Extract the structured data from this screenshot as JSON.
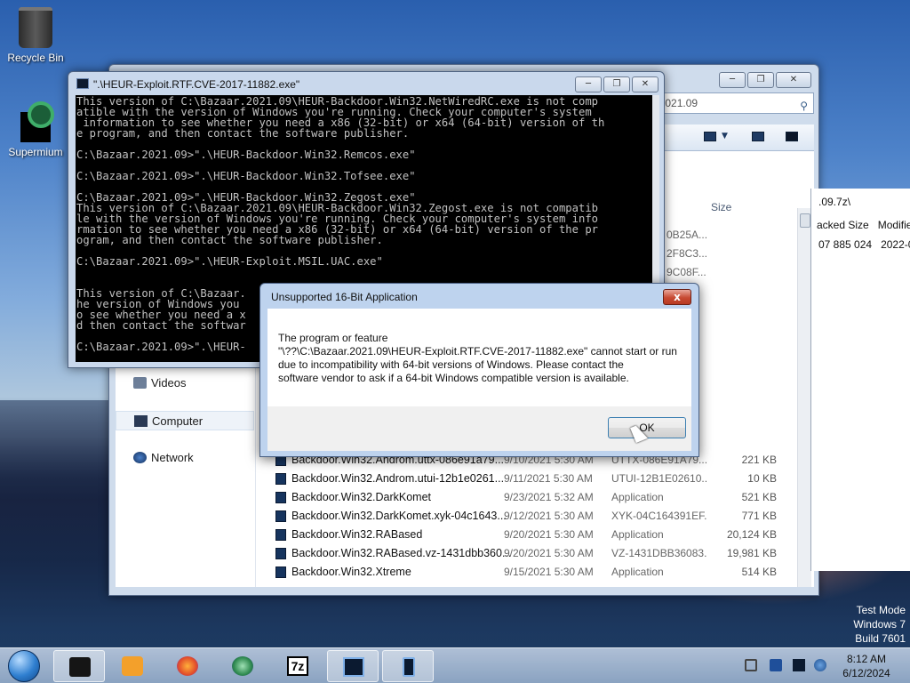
{
  "desktop": {
    "icons": [
      {
        "label": "Recycle Bin",
        "icon": "recycle-bin-icon"
      },
      {
        "label": "Supermium",
        "icon": "supermium-icon"
      }
    ],
    "watermark": [
      "Test Mode",
      "Windows 7",
      "Build 7601"
    ]
  },
  "explorer": {
    "address": "...r.2021.09",
    "column_size": "Size",
    "nav": [
      {
        "label": "Videos",
        "icon": "videos-icon"
      },
      {
        "label": "Computer",
        "icon": "computer-icon"
      },
      {
        "label": "Network",
        "icon": "network-icon"
      }
    ],
    "partial_rows": [
      {
        "type": "0B25A...",
        "size": "942 KB"
      },
      {
        "type": "2F8C3...",
        "size": "3,533 KB"
      },
      {
        "type": "9C08F...",
        "size": "1,217 KB"
      },
      {
        "type": "",
        "size": "820 KB"
      },
      {
        "type": "",
        "size": "599 KB"
      },
      {
        "type": "",
        "size": "550 KB"
      },
      {
        "type": "",
        "size": "5,350 KB"
      },
      {
        "type": "",
        "size": "319 KB"
      },
      {
        "type": "",
        "size": "220 KB"
      },
      {
        "type": "",
        "size": "369 KB"
      },
      {
        "type": "",
        "size": "586 KB"
      },
      {
        "type": "",
        "size": "164 KB"
      }
    ],
    "rows": [
      {
        "name": "Backdoor.Win32.Androm.uttx-086e91a79...",
        "date": "9/10/2021 5:30 AM",
        "type": "UTTX-086E91A79...",
        "size": "221 KB"
      },
      {
        "name": "Backdoor.Win32.Androm.utui-12b1e0261...",
        "date": "9/11/2021 5:30 AM",
        "type": "UTUI-12B1E02610...",
        "size": "10 KB"
      },
      {
        "name": "Backdoor.Win32.DarkKomet",
        "date": "9/23/2021 5:32 AM",
        "type": "Application",
        "size": "521 KB"
      },
      {
        "name": "Backdoor.Win32.DarkKomet.xyk-04c1643...",
        "date": "9/12/2021 5:30 AM",
        "type": "XYK-04C164391EF...",
        "size": "771 KB"
      },
      {
        "name": "Backdoor.Win32.RABased",
        "date": "9/20/2021 5:30 AM",
        "type": "Application",
        "size": "20,124 KB"
      },
      {
        "name": "Backdoor.Win32.RABased.vz-1431dbb360...",
        "date": "9/20/2021 5:30 AM",
        "type": "VZ-1431DBB36083...",
        "size": "19,981 KB"
      },
      {
        "name": "Backdoor.Win32.Xtreme",
        "date": "9/15/2021 5:30 AM",
        "type": "Application",
        "size": "514 KB"
      }
    ]
  },
  "sevenzip": {
    "path": ".09.7z\\",
    "col_packed": "acked Size",
    "col_modified": "Modifie",
    "packed_value": "07 885 024",
    "modified_value": "2022-0"
  },
  "console": {
    "title": "\".\\HEUR-Exploit.RTF.CVE-2017-11882.exe\"",
    "lines": [
      "This version of C:\\Bazaar.2021.09\\HEUR-Backdoor.Win32.NetWiredRC.exe is not comp",
      "atible with the version of Windows you're running. Check your computer's system",
      " information to see whether you need a x86 (32-bit) or x64 (64-bit) version of th",
      "e program, and then contact the software publisher.",
      "",
      "C:\\Bazaar.2021.09>\".\\HEUR-Backdoor.Win32.Remcos.exe\"",
      "",
      "C:\\Bazaar.2021.09>\".\\HEUR-Backdoor.Win32.Tofsee.exe\"",
      "",
      "C:\\Bazaar.2021.09>\".\\HEUR-Backdoor.Win32.Zegost.exe\"",
      "This version of C:\\Bazaar.2021.09\\HEUR-Backdoor.Win32.Zegost.exe is not compatib",
      "le with the version of Windows you're running. Check your computer's system info",
      "rmation to see whether you need a x86 (32-bit) or x64 (64-bit) version of the pr",
      "ogram, and then contact the software publisher.",
      "",
      "C:\\Bazaar.2021.09>\".\\HEUR-Exploit.MSIL.UAC.exe\"",
      "",
      "",
      "This version of C:\\Bazaar.",
      "he version of Windows you",
      "o see whether you need a x",
      "d then contact the softwar",
      "",
      "C:\\Bazaar.2021.09>\".\\HEUR-"
    ]
  },
  "dialog": {
    "title": "Unsupported 16-Bit Application",
    "close": "x",
    "message_lines": [
      "The program or feature",
      "\"\\??\\C:\\Bazaar.2021.09\\HEUR-Exploit.RTF.CVE-2017-11882.exe\" cannot start or run",
      "due to incompatibility with 64-bit versions of Windows. Please contact the",
      "software vendor to ask if a 64-bit Windows compatible version is available."
    ],
    "ok_label": "OK"
  },
  "taskbar": {
    "items": [
      {
        "icon": "app-icon-dark-box"
      },
      {
        "icon": "media-player-icon"
      },
      {
        "icon": "firefox-icon"
      },
      {
        "icon": "supermium-icon"
      },
      {
        "icon": "7zip-icon",
        "label": "7z"
      },
      {
        "icon": "console-icon",
        "active": true
      },
      {
        "icon": "tablet-icon"
      }
    ],
    "time": "8:12 AM",
    "date": "6/12/2024"
  },
  "colors": {
    "accent": "#2f7fd0",
    "dialog_close": "#c74a32",
    "console_bg": "#000000",
    "console_text": "#c0c0c0"
  }
}
